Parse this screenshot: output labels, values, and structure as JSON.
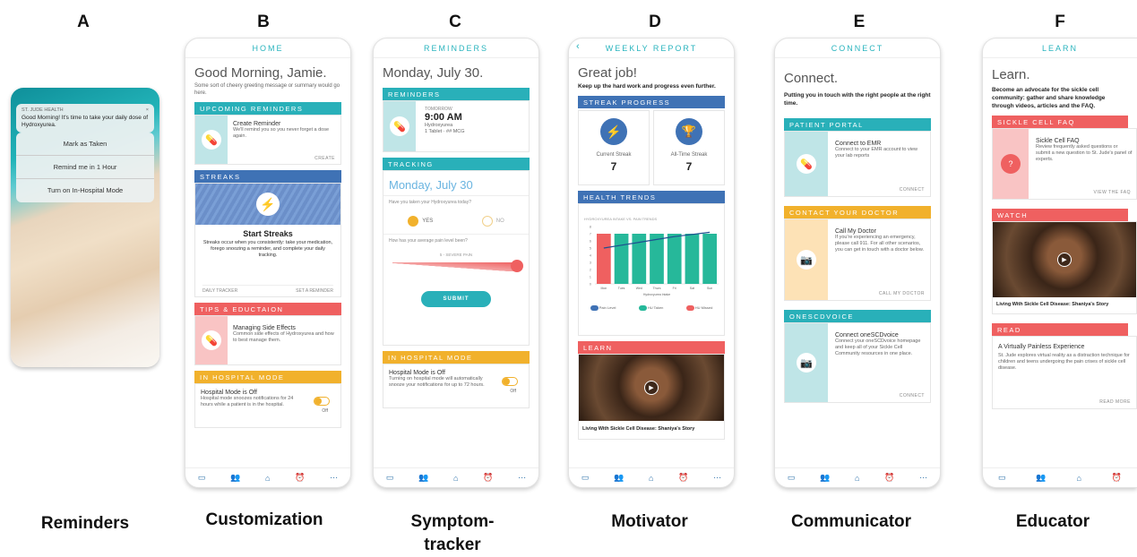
{
  "letters": {
    "a": "A",
    "b": "B",
    "c": "C",
    "d": "D",
    "e": "E",
    "f": "F"
  },
  "captions": {
    "a": "Reminders",
    "b": "Customization",
    "c": "Symptom-",
    "c2": "tracker",
    "d": "Motivator",
    "e": "Communicator",
    "f": "Educator"
  },
  "a": {
    "app": "ST. JUDE HEALTH",
    "message": "Good Morning! It's time to take your daily dose of Hydroxyurea.",
    "close": "×",
    "actions": [
      "Mark as Taken",
      "Remind me in 1 Hour",
      "Turn on In-Hospital Mode"
    ]
  },
  "b": {
    "title": "HOME",
    "greeting": "Good Morning, Jamie.",
    "sub": "Some sort of cheery greeting message or summary would go here.",
    "reminders": {
      "bar": "UPCOMING REMINDERS",
      "title": "Create Reminder",
      "text": "We'll remind you so you never forget a dose again.",
      "link": "CREATE"
    },
    "streaks": {
      "bar": "STREAKS",
      "title": "Start Streaks",
      "text": "Streaks occur when you consistently: take your medication, forego snoozing a reminder, and complete your daily tracking.",
      "link1": "DAILY TRACKER",
      "link2": "SET A REMINDER"
    },
    "tips": {
      "bar": "TIPS & EDUCTAION",
      "title": "Managing Side Effects",
      "text": "Common side effects of Hydroxyurea and how to best manage them."
    },
    "hospital": {
      "bar": "IN HOSPITAL MODE",
      "title": "Hospital Mode is Off",
      "text": "Hospital mode snoozes notifications for 24 hours while a patient is in the hospital.",
      "toggle": "Off"
    },
    "nav": [
      "Home"
    ]
  },
  "c": {
    "title": "REMINDERS",
    "date": "Monday, July 30.",
    "reminders": {
      "bar": "REMINDERS",
      "when": "TOMORROW",
      "time": "9:00 AM",
      "drug": "Hydroxyurea",
      "dose": "1 Tablet · ## MCG"
    },
    "tracking": {
      "bar": "TRACKING",
      "date": "Monday, July 30",
      "q1": "Have you taken your Hydroxyurea today?",
      "yes": "YES",
      "no": "NO",
      "q2": "How has your average pain level been?",
      "slider": "5 - SEVERE PAIN",
      "submit": "SUBMIT"
    },
    "hospital": {
      "bar": "IN HOSPITAL MODE",
      "title": "Hospital Mode is Off",
      "text": "Turning on hospital mode will automatically snooze your notifications for up to 72 hours.",
      "toggle": "Off"
    }
  },
  "d": {
    "title": "WEEKLY REPORT",
    "back": "‹",
    "head": "Great job!",
    "sub": "Keep up the hard work and progress even further.",
    "streak": {
      "bar": "STREAK PROGRESS",
      "current_label": "Current Streak",
      "current": "7",
      "alltime_label": "All-Time Streak",
      "alltime": "7"
    },
    "trends": {
      "bar": "HEALTH TRENDS",
      "chart_title": "HYDROXYUREA INTAKE VS. PAIN TRENDS",
      "days": [
        "Mon",
        "Tues",
        "Wed",
        "Thurs",
        "Fri",
        "Sat",
        "Sun"
      ],
      "yticks": [
        "8",
        "7",
        "6",
        "5",
        "4",
        "3",
        "2",
        "1",
        "0"
      ],
      "xlabel": "Hydroxyurea Intake",
      "legend": [
        "Pain Level",
        "HU Taken",
        "HU Missed"
      ]
    },
    "learn": {
      "bar": "LEARN",
      "caption": "Living With Sickle Cell Disease: Shaniya's Story"
    }
  },
  "chart_data": {
    "type": "bar",
    "title": "HYDROXYUREA INTAKE VS. PAIN TRENDS",
    "categories": [
      "Mon",
      "Tues",
      "Wed",
      "Thurs",
      "Fri",
      "Sat",
      "Sun"
    ],
    "series": [
      {
        "name": "HU Missed",
        "values": [
          7,
          0,
          0,
          0,
          0,
          0,
          0
        ]
      },
      {
        "name": "HU Taken",
        "values": [
          0,
          7,
          7,
          7,
          7,
          7,
          7
        ]
      },
      {
        "name": "Pain Level",
        "values": [
          5,
          5.4,
          5.8,
          6.2,
          6.6,
          6.9,
          7.2
        ]
      }
    ],
    "xlabel": "Hydroxyurea Intake",
    "ylim": [
      0,
      8
    ],
    "legend": "bottom"
  },
  "e": {
    "title": "CONNECT",
    "head": "Connect.",
    "sub": "Putting you in touch with the right people at the right time.",
    "portal": {
      "bar": "PATIENT PORTAL",
      "title": "Connect to EMR",
      "text": "Connect to your EMR account to view your lab reports",
      "link": "CONNECT"
    },
    "doctor": {
      "bar": "CONTACT YOUR DOCTOR",
      "title": "Call My Doctor",
      "text": "If you're experiencing an emergency, please call 911. For all other scenarios, you can get in touch with a doctor below.",
      "link": "CALL MY DOCTOR"
    },
    "voice": {
      "bar": "ONESCDVOICE",
      "title": "Connect oneSCDvoice",
      "text": "Connect your oneSCDvoice homepage and keep all of your Sickle Cell Community resources in one place.",
      "link": "CONNECT"
    },
    "nav": [
      "Connect",
      "Home",
      "Reminders"
    ]
  },
  "f": {
    "title": "LEARN",
    "head": "Learn.",
    "sub": "Become an advocate for the sickle cell community: gather and share knowledge through videos, articles and the FAQ.",
    "faq": {
      "bar": "SICKLE CELL FAQ",
      "title": "Sickle Cell FAQ",
      "text": "Review frequently asked questions or submit a new question to St. Jude's panel of experts.",
      "link": "VIEW THE FAQ"
    },
    "watch": {
      "bar": "WATCH",
      "caption": "Living With Sickle Cell Disease: Shaniya's Story"
    },
    "read": {
      "bar": "READ",
      "title": "A Virtually Painless Experience",
      "text": "St. Jude explores virtual reality as a distraction technique for children and teens undergoing the pain crises of sickle cell disease.",
      "link": "READ MORE"
    },
    "nav": [
      "Home"
    ]
  }
}
